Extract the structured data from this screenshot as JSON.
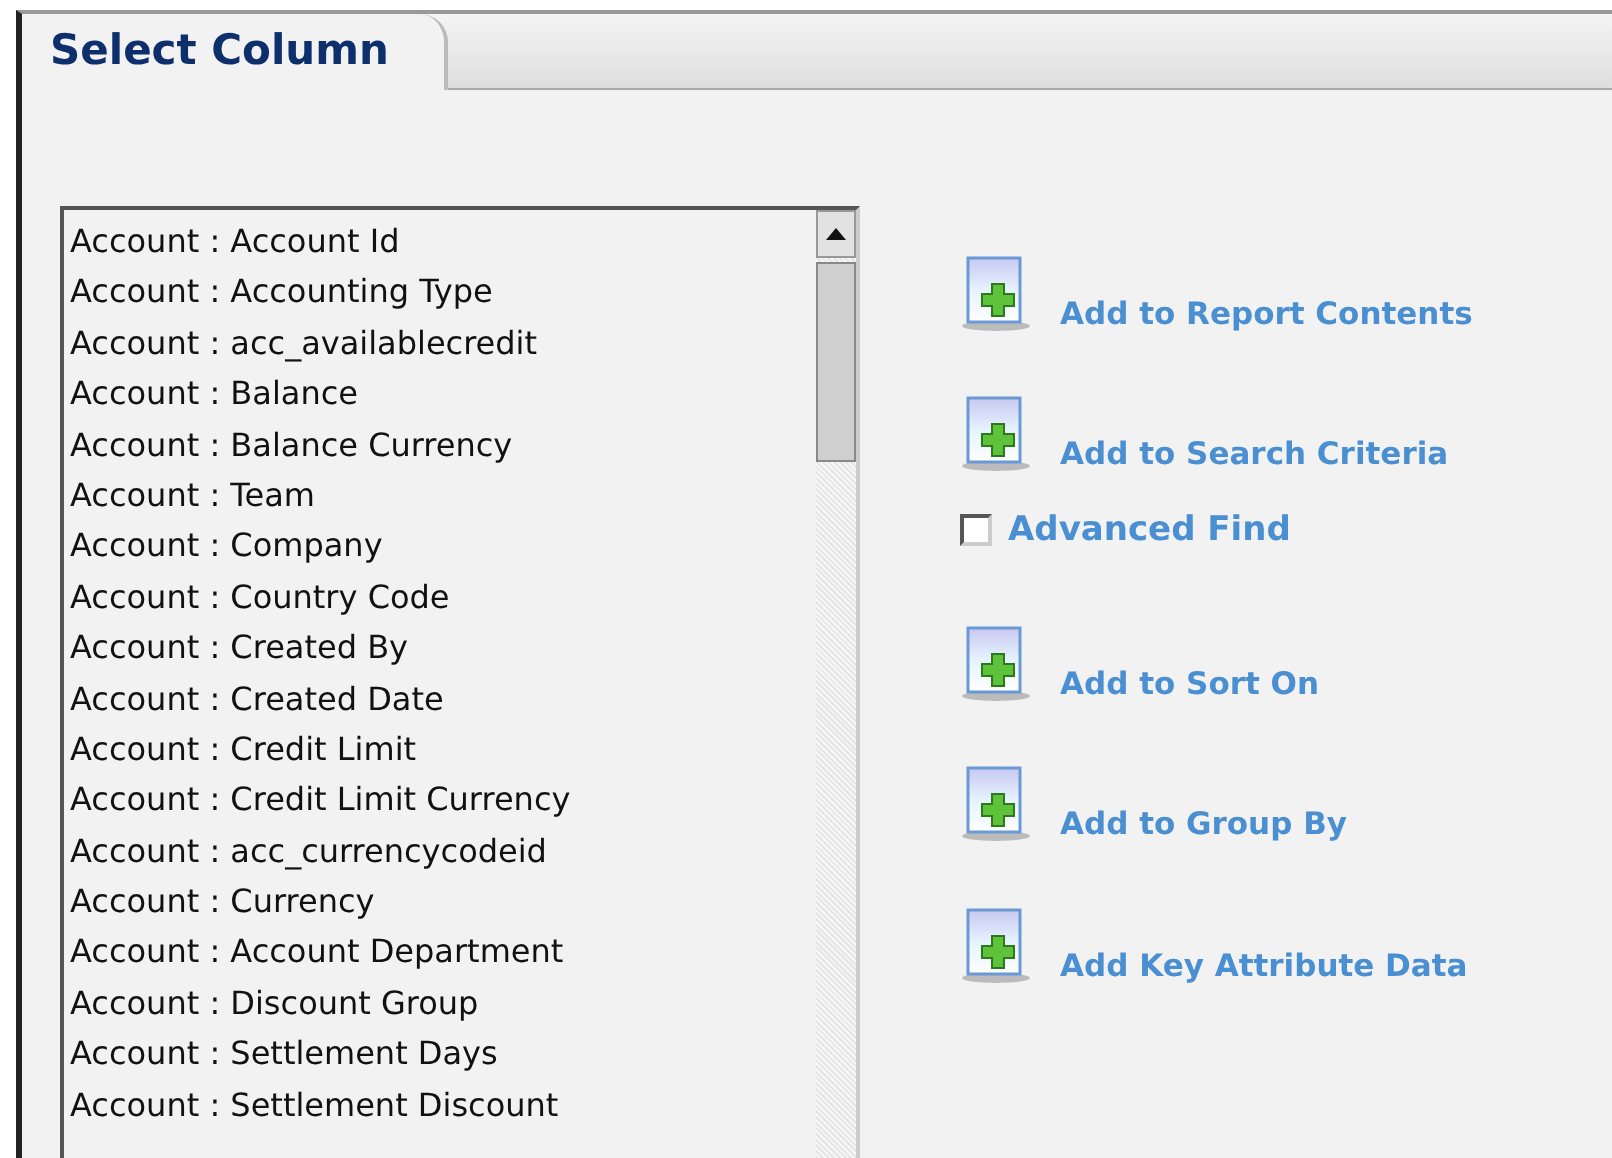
{
  "tabs": [
    {
      "label": "Select Column",
      "selected": true
    }
  ],
  "columns_list": {
    "items": [
      {
        "label": "Account : Account Id",
        "selected": false
      },
      {
        "label": "Account : Accounting Type",
        "selected": false
      },
      {
        "label": "Account : acc_availablecredit",
        "selected": false
      },
      {
        "label": "Account : Balance",
        "selected": false
      },
      {
        "label": "Account : Balance Currency",
        "selected": false
      },
      {
        "label": "Account : Team",
        "selected": false
      },
      {
        "label": "Account : Company",
        "selected": false
      },
      {
        "label": "Account : Country Code",
        "selected": false
      },
      {
        "label": "Account : Created By",
        "selected": false
      },
      {
        "label": "Account : Created Date",
        "selected": false
      },
      {
        "label": "Account : Credit Limit",
        "selected": false
      },
      {
        "label": "Account : Credit Limit Currency",
        "selected": false
      },
      {
        "label": "Account : acc_currencycodeid",
        "selected": false
      },
      {
        "label": "Account : Currency",
        "selected": false
      },
      {
        "label": "Account : Account Department",
        "selected": false
      },
      {
        "label": "Account : Discount Group",
        "selected": false
      },
      {
        "label": "Account : Settlement Days",
        "selected": false
      },
      {
        "label": "Account : Settlement Discount",
        "selected": false
      }
    ]
  },
  "actions": [
    {
      "kind": "button",
      "label": "Add to Report Contents"
    },
    {
      "kind": "button",
      "label": "Add to Search Criteria"
    },
    {
      "kind": "checkbox",
      "label": "Advanced Find",
      "checked": false
    },
    {
      "kind": "button",
      "label": "Add to Sort On"
    },
    {
      "kind": "button",
      "label": "Add to Group By"
    },
    {
      "kind": "button",
      "label": "Add Key Attribute Data"
    }
  ]
}
